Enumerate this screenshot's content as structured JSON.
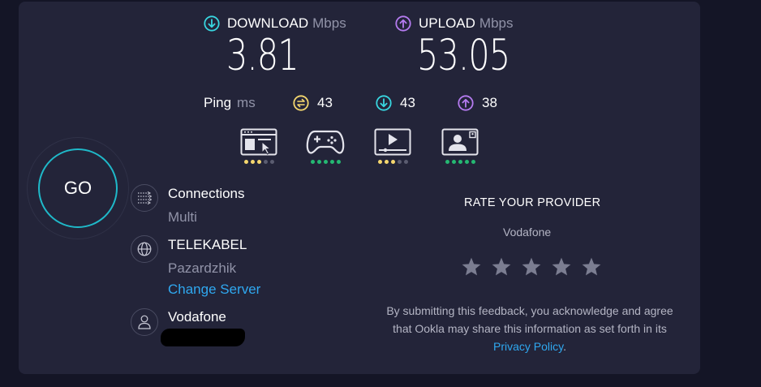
{
  "download": {
    "label": "DOWNLOAD",
    "unit": "Mbps",
    "value": "3.81",
    "icon": "arrow-down-circle-icon",
    "color": "#38d6e0"
  },
  "upload": {
    "label": "UPLOAD",
    "unit": "Mbps",
    "value": "53.05",
    "icon": "arrow-up-circle-icon",
    "color": "#b57bf0"
  },
  "ping": {
    "label": "Ping",
    "unit": "ms",
    "idle": "43",
    "download": "43",
    "upload": "38",
    "idle_color": "#f5d76e"
  },
  "quality": [
    {
      "name": "web-browsing",
      "icon": "browser-icon",
      "level": 3,
      "of": 5,
      "color": "#f5d76e"
    },
    {
      "name": "gaming",
      "icon": "gamepad-icon",
      "level": 5,
      "of": 5,
      "color": "#25b872"
    },
    {
      "name": "streaming",
      "icon": "video-play-icon",
      "level": 3,
      "of": 5,
      "color": "#f5d76e"
    },
    {
      "name": "video-chat",
      "icon": "video-call-icon",
      "level": 5,
      "of": 5,
      "color": "#25b872"
    }
  ],
  "go": {
    "label": "GO"
  },
  "connections": {
    "title": "Connections",
    "value": "Multi"
  },
  "server": {
    "name": "TELEKABEL",
    "location": "Pazardzhik",
    "change_label": "Change Server"
  },
  "provider": {
    "name": "Vodafone"
  },
  "rate": {
    "title": "RATE YOUR PROVIDER",
    "provider": "Vodafone",
    "stars": 5,
    "disclaimer_text": "By submitting this feedback, you acknowledge and agree that Ookla may share this information as set forth in its ",
    "privacy_link": "Privacy Policy",
    "period": "."
  },
  "colors": {
    "accent": "#1fb9c9",
    "link": "#2fa8f0",
    "panel": "#232439",
    "background": "#141526"
  }
}
